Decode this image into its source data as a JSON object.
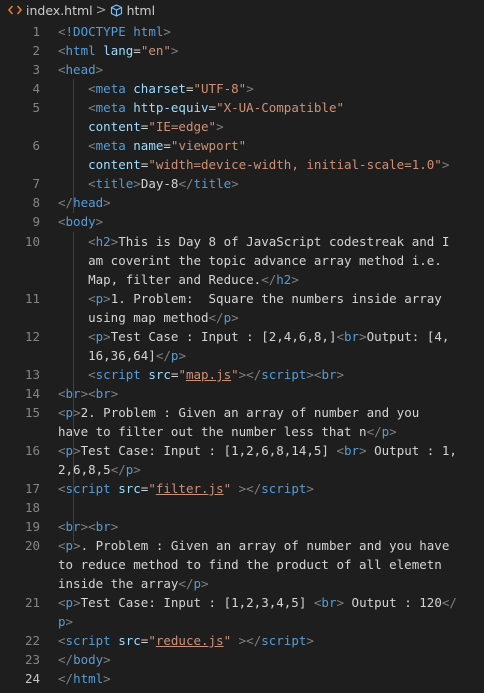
{
  "breadcrumb": {
    "file": "index.html",
    "separator": ">",
    "symbol": "html",
    "file_icon": "code-chevrons-icon",
    "symbol_icon": "cube-symbol-icon"
  },
  "colors": {
    "background": "#1e1e1e",
    "tag": "#569cd6",
    "attr_name": "#9cdcfe",
    "attr_value": "#ce9178",
    "punctuation": "#808080",
    "text": "#d4d4d4",
    "line_number": "#858585"
  },
  "editor": {
    "line_numbers": [
      "1",
      "2",
      "3",
      "4",
      "5",
      "6",
      "7",
      "8",
      "9",
      "10",
      "11",
      "12",
      "13",
      "14",
      "15",
      "16",
      "17",
      "18",
      "19",
      "20",
      "21",
      "22",
      "23",
      "24"
    ],
    "active_line": "24",
    "rows": [
      [
        [
          "pun",
          "<"
        ],
        [
          "tag",
          "!DOCTYPE "
        ],
        [
          "tag",
          "html"
        ],
        [
          "pun",
          ">"
        ]
      ],
      [
        [
          "pun",
          "<"
        ],
        [
          "tag",
          "html "
        ],
        [
          "an",
          "lang"
        ],
        [
          "txt",
          "="
        ],
        [
          "av",
          "\"en\""
        ],
        [
          "pun",
          ">"
        ]
      ],
      [
        [
          "pun",
          "<"
        ],
        [
          "tag",
          "head"
        ],
        [
          "pun",
          ">"
        ]
      ],
      [
        [
          "txt",
          "    "
        ],
        [
          "pun",
          "<"
        ],
        [
          "tag",
          "meta "
        ],
        [
          "an",
          "charset"
        ],
        [
          "txt",
          "="
        ],
        [
          "av",
          "\"UTF-8\""
        ],
        [
          "pun",
          ">"
        ]
      ],
      [
        [
          "txt",
          "    "
        ],
        [
          "pun",
          "<"
        ],
        [
          "tag",
          "meta "
        ],
        [
          "an",
          "http-equiv"
        ],
        [
          "txt",
          "="
        ],
        [
          "av",
          "\"X-UA-Compatible\""
        ]
      ],
      [
        [
          "txt",
          "    "
        ],
        [
          "an",
          "content"
        ],
        [
          "txt",
          "="
        ],
        [
          "av",
          "\"IE=edge\""
        ],
        [
          "pun",
          ">"
        ]
      ],
      [
        [
          "txt",
          "    "
        ],
        [
          "pun",
          "<"
        ],
        [
          "tag",
          "meta "
        ],
        [
          "an",
          "name"
        ],
        [
          "txt",
          "="
        ],
        [
          "av",
          "\"viewport\""
        ]
      ],
      [
        [
          "txt",
          "    "
        ],
        [
          "an",
          "content"
        ],
        [
          "txt",
          "="
        ],
        [
          "av",
          "\"width=device-width, initial-scale=1.0\""
        ],
        [
          "pun",
          ">"
        ]
      ],
      [
        [
          "txt",
          "    "
        ],
        [
          "pun",
          "<"
        ],
        [
          "tag",
          "title"
        ],
        [
          "pun",
          ">"
        ],
        [
          "txt",
          "Day-8"
        ],
        [
          "pun",
          "</"
        ],
        [
          "tag",
          "title"
        ],
        [
          "pun",
          ">"
        ]
      ],
      [
        [
          "pun",
          "</"
        ],
        [
          "tag",
          "head"
        ],
        [
          "pun",
          ">"
        ]
      ],
      [
        [
          "pun",
          "<"
        ],
        [
          "tag",
          "body"
        ],
        [
          "pun",
          ">"
        ]
      ],
      [
        [
          "txt",
          "    "
        ],
        [
          "pun",
          "<"
        ],
        [
          "tag",
          "h2"
        ],
        [
          "pun",
          ">"
        ],
        [
          "txt",
          "This is Day 8 of JavaScript codestreak and I"
        ]
      ],
      [
        [
          "txt",
          "    am coverint the topic advance array method i.e."
        ]
      ],
      [
        [
          "txt",
          "    Map, filter and Reduce."
        ],
        [
          "pun",
          "</"
        ],
        [
          "tag",
          "h2"
        ],
        [
          "pun",
          ">"
        ]
      ],
      [
        [
          "txt",
          "    "
        ],
        [
          "pun",
          "<"
        ],
        [
          "tag",
          "p"
        ],
        [
          "pun",
          ">"
        ],
        [
          "txt",
          "1. Problem:  Square the numbers inside array"
        ]
      ],
      [
        [
          "txt",
          "    using map method"
        ],
        [
          "pun",
          "</"
        ],
        [
          "tag",
          "p"
        ],
        [
          "pun",
          ">"
        ]
      ],
      [
        [
          "txt",
          "    "
        ],
        [
          "pun",
          "<"
        ],
        [
          "tag",
          "p"
        ],
        [
          "pun",
          ">"
        ],
        [
          "txt",
          "Test Case : Input : [2,4,6,8,]"
        ],
        [
          "pun",
          "<"
        ],
        [
          "tag",
          "br"
        ],
        [
          "pun",
          ">"
        ],
        [
          "txt",
          "Output: [4,"
        ]
      ],
      [
        [
          "txt",
          "    16,36,64]"
        ],
        [
          "pun",
          "</"
        ],
        [
          "tag",
          "p"
        ],
        [
          "pun",
          ">"
        ]
      ],
      [
        [
          "txt",
          "    "
        ],
        [
          "pun",
          "<"
        ],
        [
          "tag",
          "script "
        ],
        [
          "an",
          "src"
        ],
        [
          "txt",
          "="
        ],
        [
          "av",
          "\""
        ],
        [
          "av u",
          "map.js"
        ],
        [
          "av",
          "\""
        ],
        [
          "pun",
          "></"
        ],
        [
          "tag",
          "script"
        ],
        [
          "pun",
          "><"
        ],
        [
          "tag",
          "br"
        ],
        [
          "pun",
          ">"
        ]
      ],
      [
        [
          "pun",
          "<"
        ],
        [
          "tag",
          "br"
        ],
        [
          "pun",
          "><"
        ],
        [
          "tag",
          "br"
        ],
        [
          "pun",
          ">"
        ]
      ],
      [
        [
          "pun",
          "<"
        ],
        [
          "tag",
          "p"
        ],
        [
          "pun",
          ">"
        ],
        [
          "txt",
          "2. Problem : Given an array of number and you"
        ]
      ],
      [
        [
          "txt",
          "have to filter out the number less that n"
        ],
        [
          "pun",
          "</"
        ],
        [
          "tag",
          "p"
        ],
        [
          "pun",
          ">"
        ]
      ],
      [
        [
          "pun",
          "<"
        ],
        [
          "tag",
          "p"
        ],
        [
          "pun",
          ">"
        ],
        [
          "txt",
          "Test Case: Input : [1,2,6,8,14,5] "
        ],
        [
          "pun",
          "<"
        ],
        [
          "tag",
          "br"
        ],
        [
          "pun",
          "> "
        ],
        [
          "txt",
          "Output : 1,"
        ]
      ],
      [
        [
          "txt",
          "2,6,8,5"
        ],
        [
          "pun",
          "</"
        ],
        [
          "tag",
          "p"
        ],
        [
          "pun",
          ">"
        ]
      ],
      [
        [
          "pun",
          "<"
        ],
        [
          "tag",
          "script "
        ],
        [
          "an",
          "src"
        ],
        [
          "txt",
          "="
        ],
        [
          "av",
          "\""
        ],
        [
          "av u",
          "filter.js"
        ],
        [
          "av",
          "\""
        ],
        [
          "txt",
          " "
        ],
        [
          "pun",
          "></"
        ],
        [
          "tag",
          "script"
        ],
        [
          "pun",
          ">"
        ]
      ],
      [],
      [
        [
          "pun",
          "<"
        ],
        [
          "tag",
          "br"
        ],
        [
          "pun",
          "><"
        ],
        [
          "tag",
          "br"
        ],
        [
          "pun",
          ">"
        ]
      ],
      [
        [
          "pun",
          "<"
        ],
        [
          "tag",
          "p"
        ],
        [
          "pun",
          ">"
        ],
        [
          "txt",
          ". Problem : Given an array of number and you have"
        ]
      ],
      [
        [
          "txt",
          "to reduce method to find the product of all elemetn"
        ]
      ],
      [
        [
          "txt",
          "inside the array"
        ],
        [
          "pun",
          "</"
        ],
        [
          "tag",
          "p"
        ],
        [
          "pun",
          ">"
        ]
      ],
      [
        [
          "pun",
          "<"
        ],
        [
          "tag",
          "p"
        ],
        [
          "pun",
          ">"
        ],
        [
          "txt",
          "Test Case: Input : [1,2,3,4,5] "
        ],
        [
          "pun",
          "<"
        ],
        [
          "tag",
          "br"
        ],
        [
          "pun",
          "> "
        ],
        [
          "txt",
          "Output : 120"
        ],
        [
          "pun",
          "</"
        ]
      ],
      [
        [
          "tag",
          "p"
        ],
        [
          "pun",
          ">"
        ]
      ],
      [
        [
          "pun",
          "<"
        ],
        [
          "tag",
          "script "
        ],
        [
          "an",
          "src"
        ],
        [
          "txt",
          "="
        ],
        [
          "av",
          "\""
        ],
        [
          "av u",
          "reduce.js"
        ],
        [
          "av",
          "\""
        ],
        [
          "txt",
          " "
        ],
        [
          "pun",
          "></"
        ],
        [
          "tag",
          "script"
        ],
        [
          "pun",
          ">"
        ]
      ],
      [
        [
          "pun",
          "</"
        ],
        [
          "tag",
          "body"
        ],
        [
          "pun",
          ">"
        ]
      ],
      [
        [
          "pun",
          "</"
        ],
        [
          "tag",
          "html"
        ],
        [
          "pun",
          ">"
        ]
      ]
    ]
  }
}
